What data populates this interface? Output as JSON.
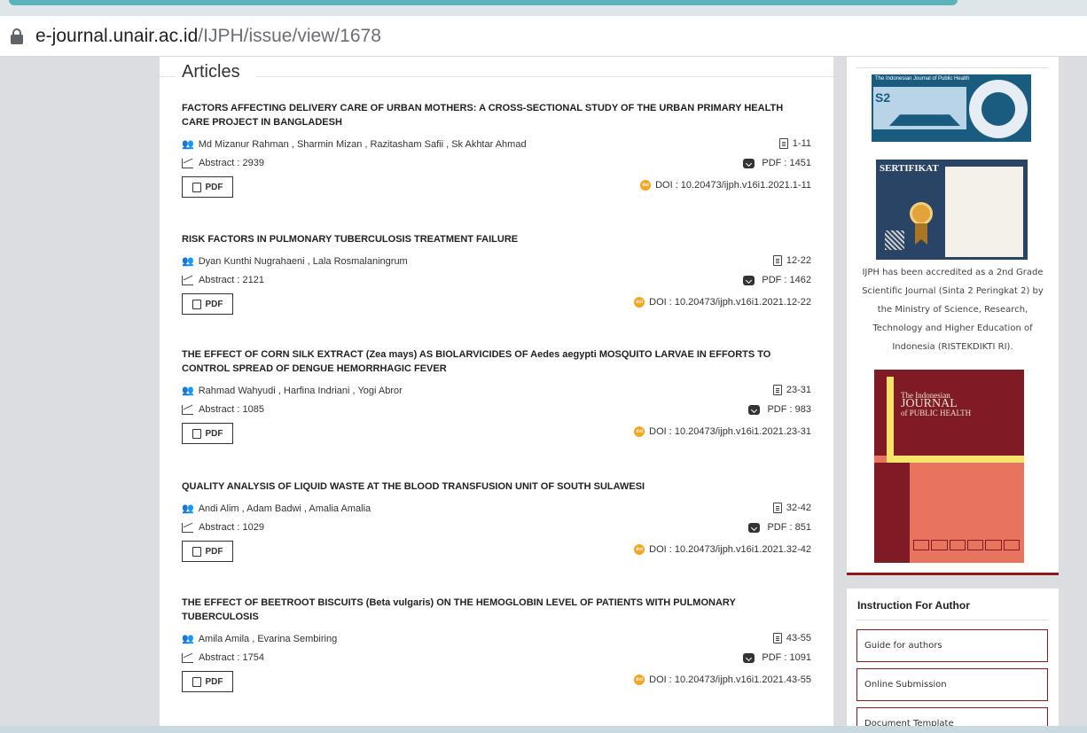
{
  "browser": {
    "url_host": "e-journal.unair.ac.id",
    "url_path": "/IJPH/issue/view/1678"
  },
  "main": {
    "section_title": "Articles",
    "pdf_label": "PDF",
    "articles": [
      {
        "title": "FACTORS AFFECTING DELIVERY CARE OF URBAN MOTHERS: A CROSS-SECTIONAL STUDY OF THE URBAN PRIMARY HEALTH CARE PROJECT IN BANGLADESH",
        "authors": "Md Mizanur Rahman , Sharmin Mizan , Razitasham Safii , Sk Akhtar Ahmad",
        "pages": "1-11",
        "abstract": "Abstract : 2939",
        "pdf_count": "PDF : 1451",
        "doi": "DOI : 10.20473/ijph.v16i1.2021.1-11"
      },
      {
        "title": "RISK FACTORS IN PULMONARY TUBERCULOSIS TREATMENT FAILURE",
        "authors": "Dyan Kunthi Nugrahaeni , Lala Rosmalaningrum",
        "pages": "12-22",
        "abstract": "Abstract : 2121",
        "pdf_count": "PDF : 1462",
        "doi": "DOI : 10.20473/ijph.v16i1.2021.12-22"
      },
      {
        "title": "THE EFFECT OF CORN SILK EXTRACT (Zea mays) AS BIOLARVICIDES OF Aedes aegypti MOSQUITO LARVAE IN EFFORTS TO CONTROL SPREAD OF DENGUE HEMORRHAGIC FEVER",
        "authors": "Rahmad Wahyudi , Harfina Indriani , Yogi Abror",
        "pages": "23-31",
        "abstract": "Abstract : 1085",
        "pdf_count": "PDF : 983",
        "doi": "DOI : 10.20473/ijph.v16i1.2021.23-31"
      },
      {
        "title": "QUALITY ANALYSIS OF LIQUID WASTE AT THE BLOOD TRANSFUSION UNIT OF SOUTH SULAWESI",
        "authors": "Andi Alim , Adam Badwi , Amalia Amalia",
        "pages": "32-42",
        "abstract": "Abstract : 1029",
        "pdf_count": "PDF : 851",
        "doi": "DOI : 10.20473/ijph.v16i1.2021.32-42"
      },
      {
        "title": "THE EFFECT OF BEETROOT BISCUITS (Beta vulgaris) ON THE HEMOGLOBIN LEVEL OF PATIENTS WITH PULMONARY TUBERCULOSIS",
        "authors": "Amila Amila , Evarina Sembiring",
        "pages": "43-55",
        "abstract": "Abstract : 1754",
        "pdf_count": "PDF : 1091",
        "doi": "DOI : 10.20473/ijph.v16i1.2021.43-55"
      }
    ]
  },
  "sidebar": {
    "sinta_title": "The Indonesian Journal of Public Health",
    "sinta_rank": "S2",
    "certificate_label": "SERTIFIKAT",
    "accreditation_text": "IJPH has been accredited as a 2nd Grade Scientific Journal (Sinta 2 Peringkat 2) by the Ministry of Science, Research, Technology and Higher Education of Indonesia (RISTEKDIKTI RI).",
    "cover_line1": "The Indonesian",
    "cover_line2": "JOURNAL",
    "cover_line3": "of PUBLIC HEALTH",
    "instruction_title": "Instruction For Author",
    "links": [
      "Guide for authors",
      "Online Submission",
      "Document Template"
    ]
  },
  "colors": {
    "accent_teal": "#5ab3b9",
    "sidebar_border": "#8b1a1a",
    "doi_badge": "#f5a623"
  }
}
